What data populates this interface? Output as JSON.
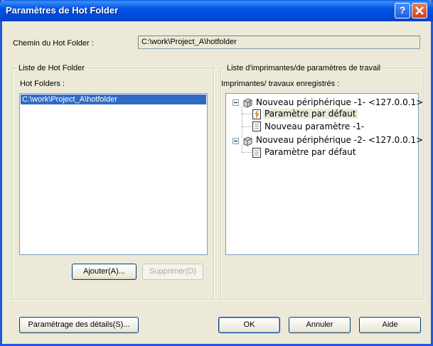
{
  "window": {
    "title": "Paramètres de Hot Folder",
    "help_button": "?",
    "close_label": "Close"
  },
  "path": {
    "label": "Chemin du Hot Folder :",
    "value": "C:\\work\\Project_A\\hotfolder"
  },
  "left_group": {
    "title": "Liste de Hot Folder",
    "list_label": "Hot Folders :",
    "items": [
      "C:\\work\\Project_A\\hotfolder"
    ],
    "add_button": "Ajouter(A)...",
    "delete_button": "Supprimer(D)"
  },
  "right_group": {
    "title": "Liste d'imprimantes/de paramètres de travail",
    "list_label": "Imprimantes/ travaux enregistrés :",
    "tree": [
      {
        "label": "Nouveau périphérique -1- <127.0.0.1>",
        "children": [
          "Paramètre par défaut",
          "Nouveau paramètre -1-"
        ]
      },
      {
        "label": "Nouveau périphérique -2- <127.0.0.1>",
        "children": [
          "Paramètre par défaut"
        ]
      }
    ]
  },
  "bottom": {
    "details_button": "Paramétrage des détails(S)...",
    "ok_button": "OK",
    "cancel_button": "Annuler",
    "help_button": "Aide"
  }
}
